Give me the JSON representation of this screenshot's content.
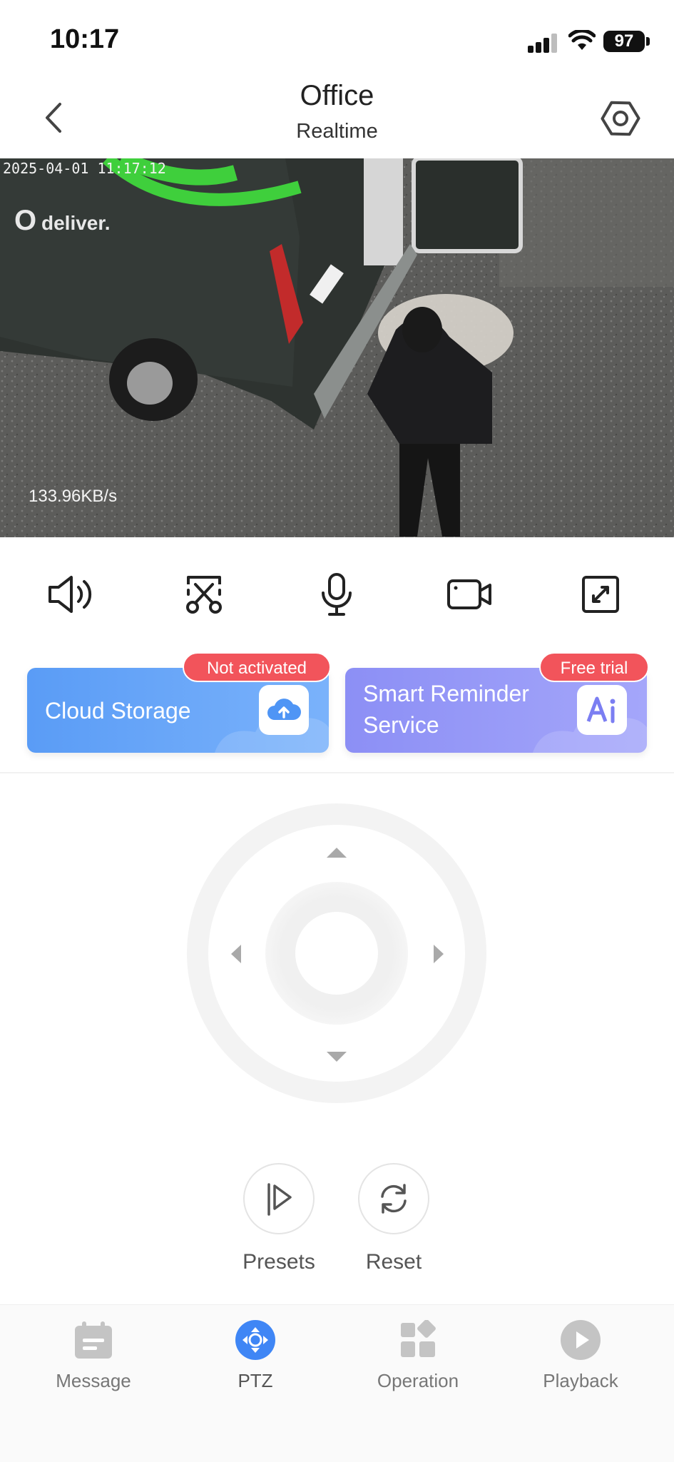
{
  "status_bar": {
    "time": "10:17",
    "battery": "97"
  },
  "header": {
    "title": "Office",
    "subtitle": "Realtime"
  },
  "video": {
    "timestamp": "2025-04-01 11:17:12",
    "bitrate": "133.96KB/s"
  },
  "controls": [
    "speaker-icon",
    "screenshot-scissors-icon",
    "microphone-icon",
    "record-video-icon",
    "fullscreen-icon"
  ],
  "services": [
    {
      "label": "Cloud Storage",
      "badge": "Not activated",
      "color": "#5a9cf6",
      "icon": "cloud-upload-icon"
    },
    {
      "label_line1": "Smart Reminder",
      "label_line2": "Service",
      "badge": "Free trial",
      "color": "#8c8ff5",
      "icon": "ai-icon"
    }
  ],
  "ptz": {
    "presets_label": "Presets",
    "reset_label": "Reset"
  },
  "nav": [
    {
      "label": "Message",
      "icon": "message-icon",
      "active": false
    },
    {
      "label": "PTZ",
      "icon": "ptz-icon",
      "active": true
    },
    {
      "label": "Operation",
      "icon": "operation-icon",
      "active": false
    },
    {
      "label": "Playback",
      "icon": "playback-icon",
      "active": false
    }
  ],
  "colors": {
    "accent": "#3f86f5",
    "badge": "#f2545b",
    "nav_inactive": "#c4c4c4"
  }
}
